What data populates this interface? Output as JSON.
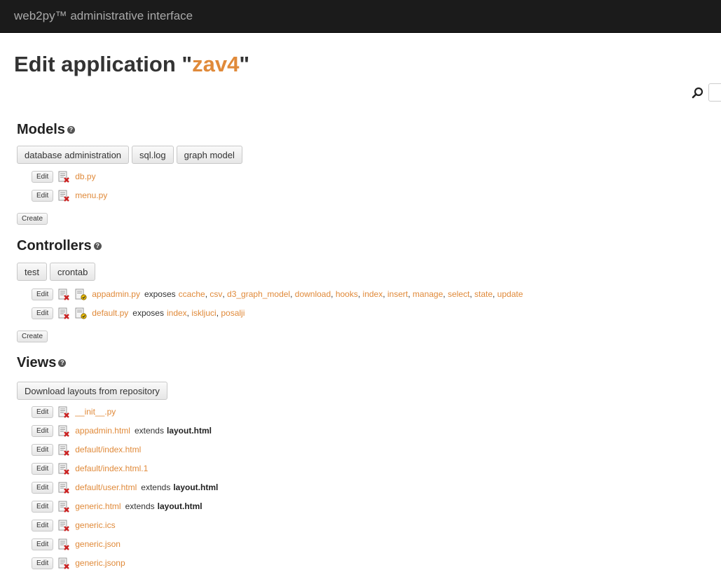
{
  "header": {
    "brand": "web2py™ administrative interface"
  },
  "title": {
    "prefix": "Edit application \"",
    "app_name": "zav4",
    "suffix": "\""
  },
  "search": {
    "value": "",
    "icon": "magnifier-icon"
  },
  "models": {
    "heading": "Models",
    "buttons": [
      "database administration",
      "sql.log",
      "graph model"
    ],
    "edit_label": "Edit",
    "files": [
      "db.py",
      "menu.py"
    ],
    "create_label": "Create"
  },
  "controllers": {
    "heading": "Controllers",
    "buttons": [
      "test",
      "crontab"
    ],
    "edit_label": "Edit",
    "exposes_label": "exposes",
    "files": [
      {
        "name": "appadmin.py",
        "exposes": [
          "ccache",
          "csv",
          "d3_graph_model",
          "download",
          "hooks",
          "index",
          "insert",
          "manage",
          "select",
          "state",
          "update"
        ]
      },
      {
        "name": "default.py",
        "exposes": [
          "index",
          "iskljuci",
          "posalji"
        ]
      }
    ],
    "create_label": "Create"
  },
  "views": {
    "heading": "Views",
    "download_button": "Download layouts from repository",
    "edit_label": "Edit",
    "extends_label": "extends",
    "files": [
      {
        "name": "__init__.py",
        "extends": ""
      },
      {
        "name": "appadmin.html",
        "extends": "layout.html"
      },
      {
        "name": "default/index.html",
        "extends": ""
      },
      {
        "name": "default/index.html.1",
        "extends": ""
      },
      {
        "name": "default/user.html",
        "extends": "layout.html"
      },
      {
        "name": "generic.html",
        "extends": "layout.html"
      },
      {
        "name": "generic.ics",
        "extends": ""
      },
      {
        "name": "generic.json",
        "extends": ""
      },
      {
        "name": "generic.jsonp",
        "extends": ""
      }
    ]
  },
  "colors": {
    "accent": "#e08a3a",
    "topbar": "#1b1b1b",
    "delete_x": "#cc2222"
  }
}
